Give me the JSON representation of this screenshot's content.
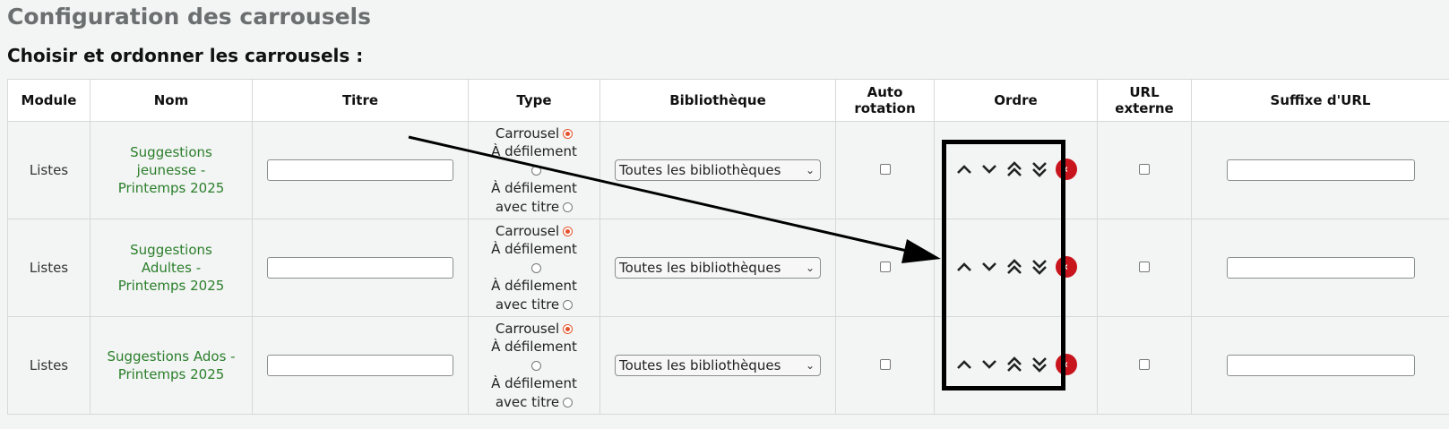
{
  "page": {
    "title": "Configuration des carrousels",
    "section_title": "Choisir et ordonner les carrousels :"
  },
  "table": {
    "headers": {
      "module": "Module",
      "nom": "Nom",
      "titre": "Titre",
      "type": "Type",
      "bibliotheque": "Bibliothèque",
      "auto_rotation_line1": "Auto",
      "auto_rotation_line2": "rotation",
      "ordre": "Ordre",
      "url_externe_line1": "URL",
      "url_externe_line2": "externe",
      "suffixe_url": "Suffixe d'URL"
    },
    "type_options": {
      "carrousel": "Carrousel",
      "defilement": "À défilement",
      "defilement_titre_line1": "À défilement",
      "defilement_titre_line2": "avec titre"
    },
    "rows": [
      {
        "module": "Listes",
        "name_lines": [
          "Suggestions",
          "jeunesse -",
          "Printemps 2025"
        ],
        "titre": "",
        "type_selected": "carrousel",
        "bibliotheque": "Toutes les bibliothèques",
        "auto_rotation": false,
        "url_externe": false,
        "suffixe": ""
      },
      {
        "module": "Listes",
        "name_lines": [
          "Suggestions",
          "Adultes -",
          "Printemps 2025"
        ],
        "titre": "",
        "type_selected": "carrousel",
        "bibliotheque": "Toutes les bibliothèques",
        "auto_rotation": false,
        "url_externe": false,
        "suffixe": ""
      },
      {
        "module": "Listes",
        "name_lines": [
          "Suggestions Ados -",
          "Printemps 2025"
        ],
        "titre": "",
        "type_selected": "carrousel",
        "bibliotheque": "Toutes les bibliothèques",
        "auto_rotation": false,
        "url_externe": false,
        "suffixe": ""
      }
    ]
  },
  "icons": {
    "move_up": "chevron-up-icon",
    "move_down": "chevron-down-icon",
    "move_top": "double-chevron-up-icon",
    "move_bottom": "double-chevron-down-icon",
    "remove": "remove-icon"
  },
  "colors": {
    "link": "#2b7f2b",
    "remove": "#c8141c",
    "radio_checked": "#e2532b",
    "annotation": "#000000"
  }
}
